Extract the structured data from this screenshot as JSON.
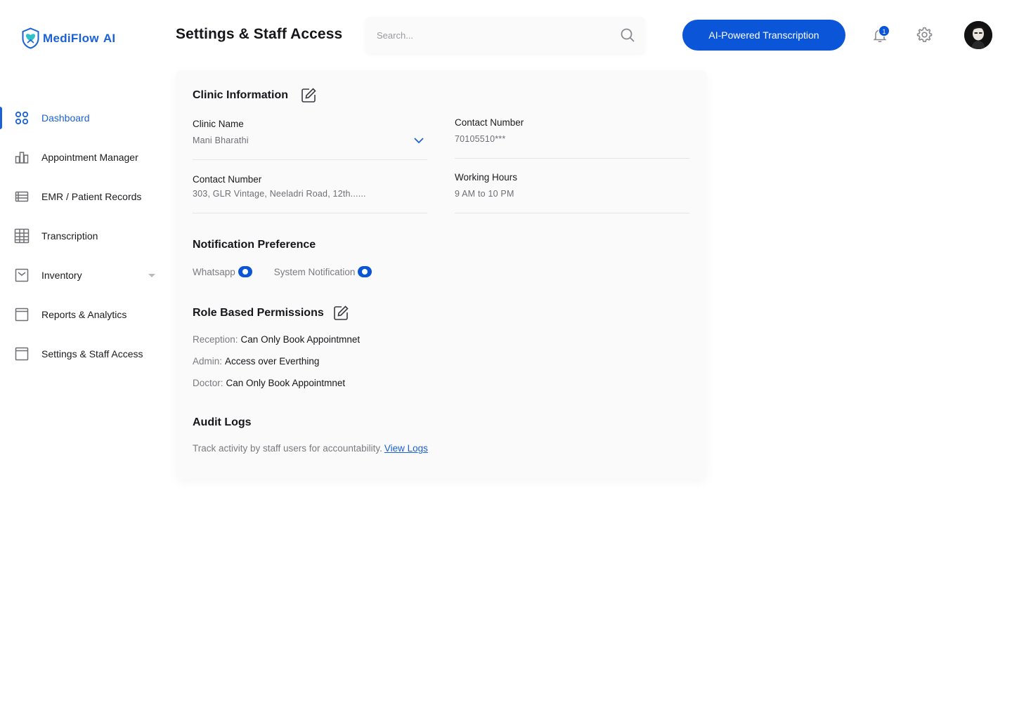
{
  "brand": {
    "name": "MediFlow",
    "suffix": "AI"
  },
  "sidebar": {
    "items": [
      {
        "label": "Dashboard",
        "icon": "dashboard-grid-icon",
        "active": true
      },
      {
        "label": "Appointment Manager",
        "icon": "bar-chart-icon"
      },
      {
        "label": "EMR / Patient Records",
        "icon": "records-list-icon"
      },
      {
        "label": "Transcription",
        "icon": "table-grid-icon"
      },
      {
        "label": "Inventory",
        "icon": "inbox-tray-icon",
        "has_dropdown": true
      },
      {
        "label": "Reports & Analytics",
        "icon": "window-icon"
      },
      {
        "label": "Settings & Staff Access",
        "icon": "window-icon"
      }
    ]
  },
  "header": {
    "title": "Settings & Staff Access",
    "search_placeholder": "Search...",
    "cta_label": "AI-Powered Transcription",
    "notification_count": "1"
  },
  "clinic_info": {
    "title": "Clinic Information",
    "clinic_name": {
      "label": "Clinic Name",
      "value": "Mani Bharathi"
    },
    "contact_number": {
      "label": "Contact Number",
      "value": "70105510***"
    },
    "address": {
      "label": "Contact Number",
      "value": "303, GLR Vintage, Neeladri Road, 12th......"
    },
    "working_hours": {
      "label": "Working Hours",
      "value": "9 AM to 10 PM"
    }
  },
  "notifications": {
    "title": "Notification Preference",
    "options": [
      {
        "label": "Whatsapp",
        "enabled": true
      },
      {
        "label": "System Notification",
        "enabled": true
      }
    ]
  },
  "permissions": {
    "title": "Role Based Permissions",
    "roles": [
      {
        "role": "Reception:",
        "access": "Can Only Book Appointmnet"
      },
      {
        "role": "Admin:",
        "access": "Access over Everthing"
      },
      {
        "role": "Doctor:",
        "access": "Can Only Book Appointmnet"
      }
    ]
  },
  "audit": {
    "title": "Audit Logs",
    "text": "Track activity by staff users for accountability.",
    "link": "View Logs"
  },
  "colors": {
    "primary": "#0b55d8",
    "brand": "#1a61d6",
    "card_bg": "#fafafa"
  }
}
